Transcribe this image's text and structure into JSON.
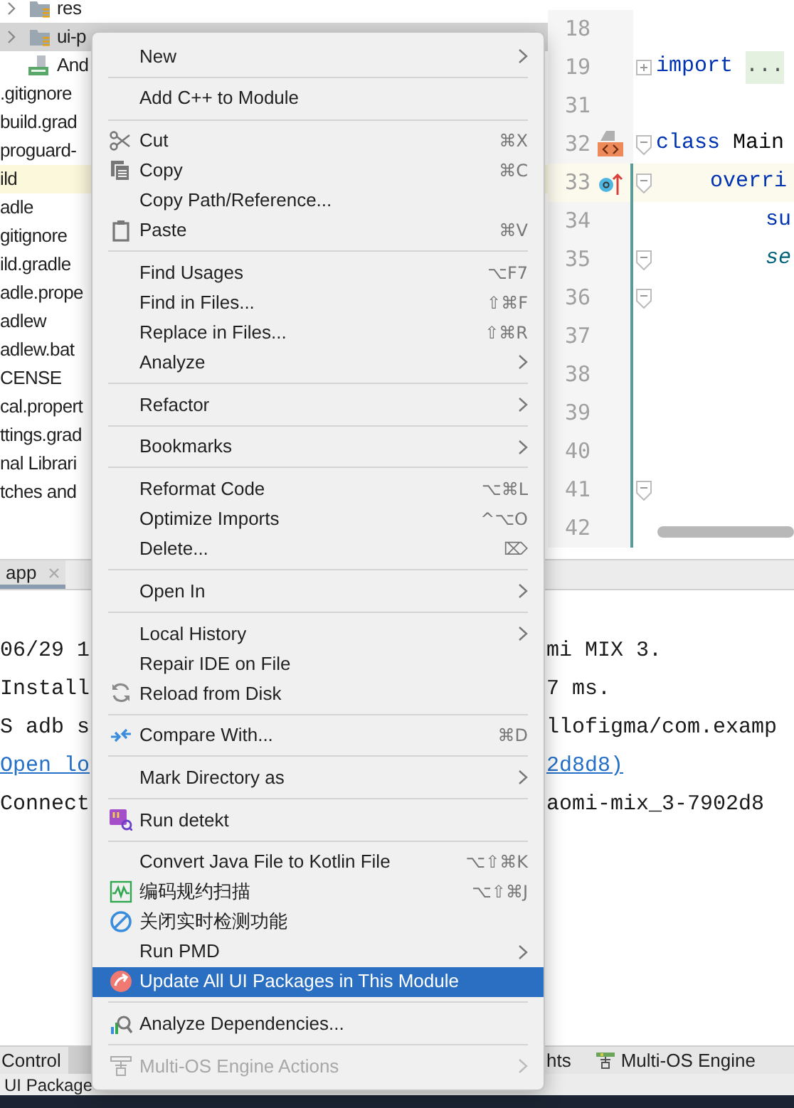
{
  "project_tree": [
    {
      "label": "res",
      "kind": "folder",
      "selected": false,
      "highlighted": false
    },
    {
      "label": "ui-p",
      "kind": "folder",
      "selected": true,
      "highlighted": false
    },
    {
      "label": "And",
      "kind": "manifest",
      "selected": false,
      "highlighted": false
    },
    {
      "label": ".gitignore",
      "kind": "file",
      "selected": false,
      "highlighted": false
    },
    {
      "label": "build.grad",
      "kind": "file",
      "selected": false,
      "highlighted": false
    },
    {
      "label": "proguard-",
      "kind": "file",
      "selected": false,
      "highlighted": false
    },
    {
      "label": "ild",
      "kind": "file",
      "selected": false,
      "highlighted": true
    },
    {
      "label": "adle",
      "kind": "file",
      "selected": false,
      "highlighted": false
    },
    {
      "label": "gitignore",
      "kind": "file",
      "selected": false,
      "highlighted": false
    },
    {
      "label": "ild.gradle",
      "kind": "file",
      "selected": false,
      "highlighted": false
    },
    {
      "label": "adle.prope",
      "kind": "file",
      "selected": false,
      "highlighted": false
    },
    {
      "label": "adlew",
      "kind": "file",
      "selected": false,
      "highlighted": false
    },
    {
      "label": "adlew.bat",
      "kind": "file",
      "selected": false,
      "highlighted": false
    },
    {
      "label": "CENSE",
      "kind": "file",
      "selected": false,
      "highlighted": false
    },
    {
      "label": "cal.propert",
      "kind": "file",
      "selected": false,
      "highlighted": false
    },
    {
      "label": "ttings.grad",
      "kind": "file",
      "selected": false,
      "highlighted": false
    },
    {
      "label": "nal Librari",
      "kind": "file",
      "selected": false,
      "highlighted": false
    },
    {
      "label": "tches and",
      "kind": "file",
      "selected": false,
      "highlighted": false
    }
  ],
  "editor": {
    "lines": [
      {
        "number": "18",
        "current": false,
        "changed": false
      },
      {
        "number": "19",
        "current": false,
        "changed": false,
        "foldable": true,
        "folded": true,
        "segments": [
          {
            "kind": "keyword",
            "text": "import"
          },
          {
            "kind": "folded",
            "text": "..."
          }
        ]
      },
      {
        "number": "31",
        "current": false,
        "changed": false
      },
      {
        "number": "32",
        "current": false,
        "changed": false,
        "foldable": true,
        "folded": false,
        "segments": [
          {
            "kind": "keyword",
            "text": "class"
          },
          {
            "kind": "plain",
            "text": "Main"
          }
        ]
      },
      {
        "number": "33",
        "current": true,
        "changed": true,
        "foldable": true,
        "folded": false,
        "segments": [
          {
            "kind": "keyword",
            "text": "overri"
          }
        ]
      },
      {
        "number": "34",
        "current": false,
        "changed": true,
        "segments": [
          {
            "kind": "call",
            "text": "su"
          }
        ]
      },
      {
        "number": "35",
        "current": false,
        "changed": true,
        "foldable": true,
        "folded": false,
        "segments": [
          {
            "kind": "italic",
            "text": "se"
          }
        ]
      },
      {
        "number": "36",
        "current": false,
        "changed": true,
        "foldable": true,
        "folded": false
      },
      {
        "number": "37",
        "current": false,
        "changed": true
      },
      {
        "number": "38",
        "current": false,
        "changed": true
      },
      {
        "number": "39",
        "current": false,
        "changed": true
      },
      {
        "number": "40",
        "current": false,
        "changed": true
      },
      {
        "number": "41",
        "current": false,
        "changed": true,
        "foldable": true,
        "folded": false
      },
      {
        "number": "42",
        "current": false,
        "changed": true
      }
    ]
  },
  "run_panel": {
    "tab": {
      "label": "app",
      "selected": true
    },
    "lines": [
      {
        "kind": "text",
        "left": "06/29 1",
        "right": "mi MIX 3."
      },
      {
        "kind": "text",
        "left": "Install",
        "right": "7 ms."
      },
      {
        "kind": "text",
        "left": "S adb s",
        "right": "llofigma/com.examp"
      },
      {
        "kind": "link",
        "left": "Open lo",
        "right": "2d8d8)"
      },
      {
        "kind": "text",
        "left": "Connect",
        "right": "aomi-mix_3-7902d8"
      }
    ]
  },
  "status_bar": {
    "left": "Control",
    "tabs": [
      "hts",
      "Multi-OS Engine"
    ],
    "message": "UI Package"
  },
  "context_menu": [
    {
      "kind": "item",
      "label": "New",
      "submenu": true,
      "selected": false,
      "disabled": false
    },
    {
      "kind": "separator"
    },
    {
      "kind": "item",
      "label": "Add C++ to Module",
      "submenu": false,
      "selected": false,
      "disabled": false
    },
    {
      "kind": "separator"
    },
    {
      "kind": "item",
      "label": "Cut",
      "shortcut": "⌘X",
      "submenu": false,
      "selected": false,
      "disabled": false
    },
    {
      "kind": "item",
      "label": "Copy",
      "shortcut": "⌘C",
      "submenu": false,
      "selected": false,
      "disabled": false
    },
    {
      "kind": "item",
      "label": "Copy Path/Reference...",
      "submenu": false,
      "selected": false,
      "disabled": false
    },
    {
      "kind": "item",
      "label": "Paste",
      "shortcut": "⌘V",
      "submenu": false,
      "selected": false,
      "disabled": false
    },
    {
      "kind": "separator"
    },
    {
      "kind": "item",
      "label": "Find Usages",
      "shortcut": "⌥F7",
      "submenu": false,
      "selected": false,
      "disabled": false
    },
    {
      "kind": "item",
      "label": "Find in Files...",
      "shortcut": "⇧⌘F",
      "submenu": false,
      "selected": false,
      "disabled": false
    },
    {
      "kind": "item",
      "label": "Replace in Files...",
      "shortcut": "⇧⌘R",
      "submenu": false,
      "selected": false,
      "disabled": false
    },
    {
      "kind": "item",
      "label": "Analyze",
      "submenu": true,
      "selected": false,
      "disabled": false
    },
    {
      "kind": "separator"
    },
    {
      "kind": "item",
      "label": "Refactor",
      "submenu": true,
      "selected": false,
      "disabled": false
    },
    {
      "kind": "separator"
    },
    {
      "kind": "item",
      "label": "Bookmarks",
      "submenu": true,
      "selected": false,
      "disabled": false
    },
    {
      "kind": "separator"
    },
    {
      "kind": "item",
      "label": "Reformat Code",
      "shortcut": "⌥⌘L",
      "submenu": false,
      "selected": false,
      "disabled": false
    },
    {
      "kind": "item",
      "label": "Optimize Imports",
      "shortcut": "^⌥O",
      "submenu": false,
      "selected": false,
      "disabled": false
    },
    {
      "kind": "item",
      "label": "Delete...",
      "shortcut": "⌦",
      "submenu": false,
      "selected": false,
      "disabled": false
    },
    {
      "kind": "separator"
    },
    {
      "kind": "item",
      "label": "Open In",
      "submenu": true,
      "selected": false,
      "disabled": false
    },
    {
      "kind": "separator"
    },
    {
      "kind": "item",
      "label": "Local History",
      "submenu": true,
      "selected": false,
      "disabled": false
    },
    {
      "kind": "item",
      "label": "Repair IDE on File",
      "submenu": false,
      "selected": false,
      "disabled": false
    },
    {
      "kind": "item",
      "label": "Reload from Disk",
      "submenu": false,
      "selected": false,
      "disabled": false
    },
    {
      "kind": "separator"
    },
    {
      "kind": "item",
      "label": "Compare With...",
      "shortcut": "⌘D",
      "submenu": false,
      "selected": false,
      "disabled": false
    },
    {
      "kind": "separator"
    },
    {
      "kind": "item",
      "label": "Mark Directory as",
      "submenu": true,
      "selected": false,
      "disabled": false
    },
    {
      "kind": "separator"
    },
    {
      "kind": "item",
      "label": "Run detekt",
      "submenu": false,
      "selected": false,
      "disabled": false
    },
    {
      "kind": "separator"
    },
    {
      "kind": "item",
      "label": "Convert Java File to Kotlin File",
      "shortcut": "⌥⇧⌘K",
      "submenu": false,
      "selected": false,
      "disabled": false
    },
    {
      "kind": "item",
      "label": "编码规约扫描",
      "shortcut": "⌥⇧⌘J",
      "submenu": false,
      "selected": false,
      "disabled": false
    },
    {
      "kind": "item",
      "label": "关闭实时检测功能",
      "submenu": false,
      "selected": false,
      "disabled": false
    },
    {
      "kind": "item",
      "label": "Run PMD",
      "submenu": true,
      "selected": false,
      "disabled": false
    },
    {
      "kind": "item",
      "label": "Update All UI Packages in This Module",
      "submenu": false,
      "selected": true,
      "disabled": false
    },
    {
      "kind": "separator"
    },
    {
      "kind": "item",
      "label": "Analyze Dependencies...",
      "submenu": false,
      "selected": false,
      "disabled": false
    },
    {
      "kind": "separator"
    },
    {
      "kind": "item",
      "label": "Multi-OS Engine Actions",
      "submenu": true,
      "selected": false,
      "disabled": true
    }
  ]
}
